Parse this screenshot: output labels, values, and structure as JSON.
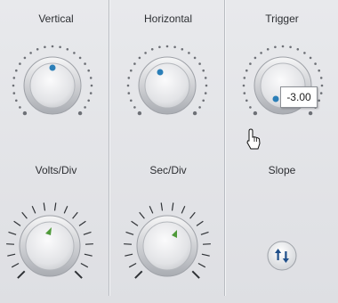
{
  "colors": {
    "accent": "#2b7fb8",
    "indicator_green": "#4f9a3a"
  },
  "vertical": {
    "label": "Vertical"
  },
  "horizontal": {
    "label": "Horizontal"
  },
  "trigger": {
    "label": "Trigger",
    "value": "-3.00"
  },
  "volts_div": {
    "label": "Volts/Div"
  },
  "sec_div": {
    "label": "Sec/Div"
  },
  "slope": {
    "label": "Slope",
    "icon": "up-down-arrows-icon"
  },
  "cursor": {
    "icon": "hand-pointer-icon"
  }
}
